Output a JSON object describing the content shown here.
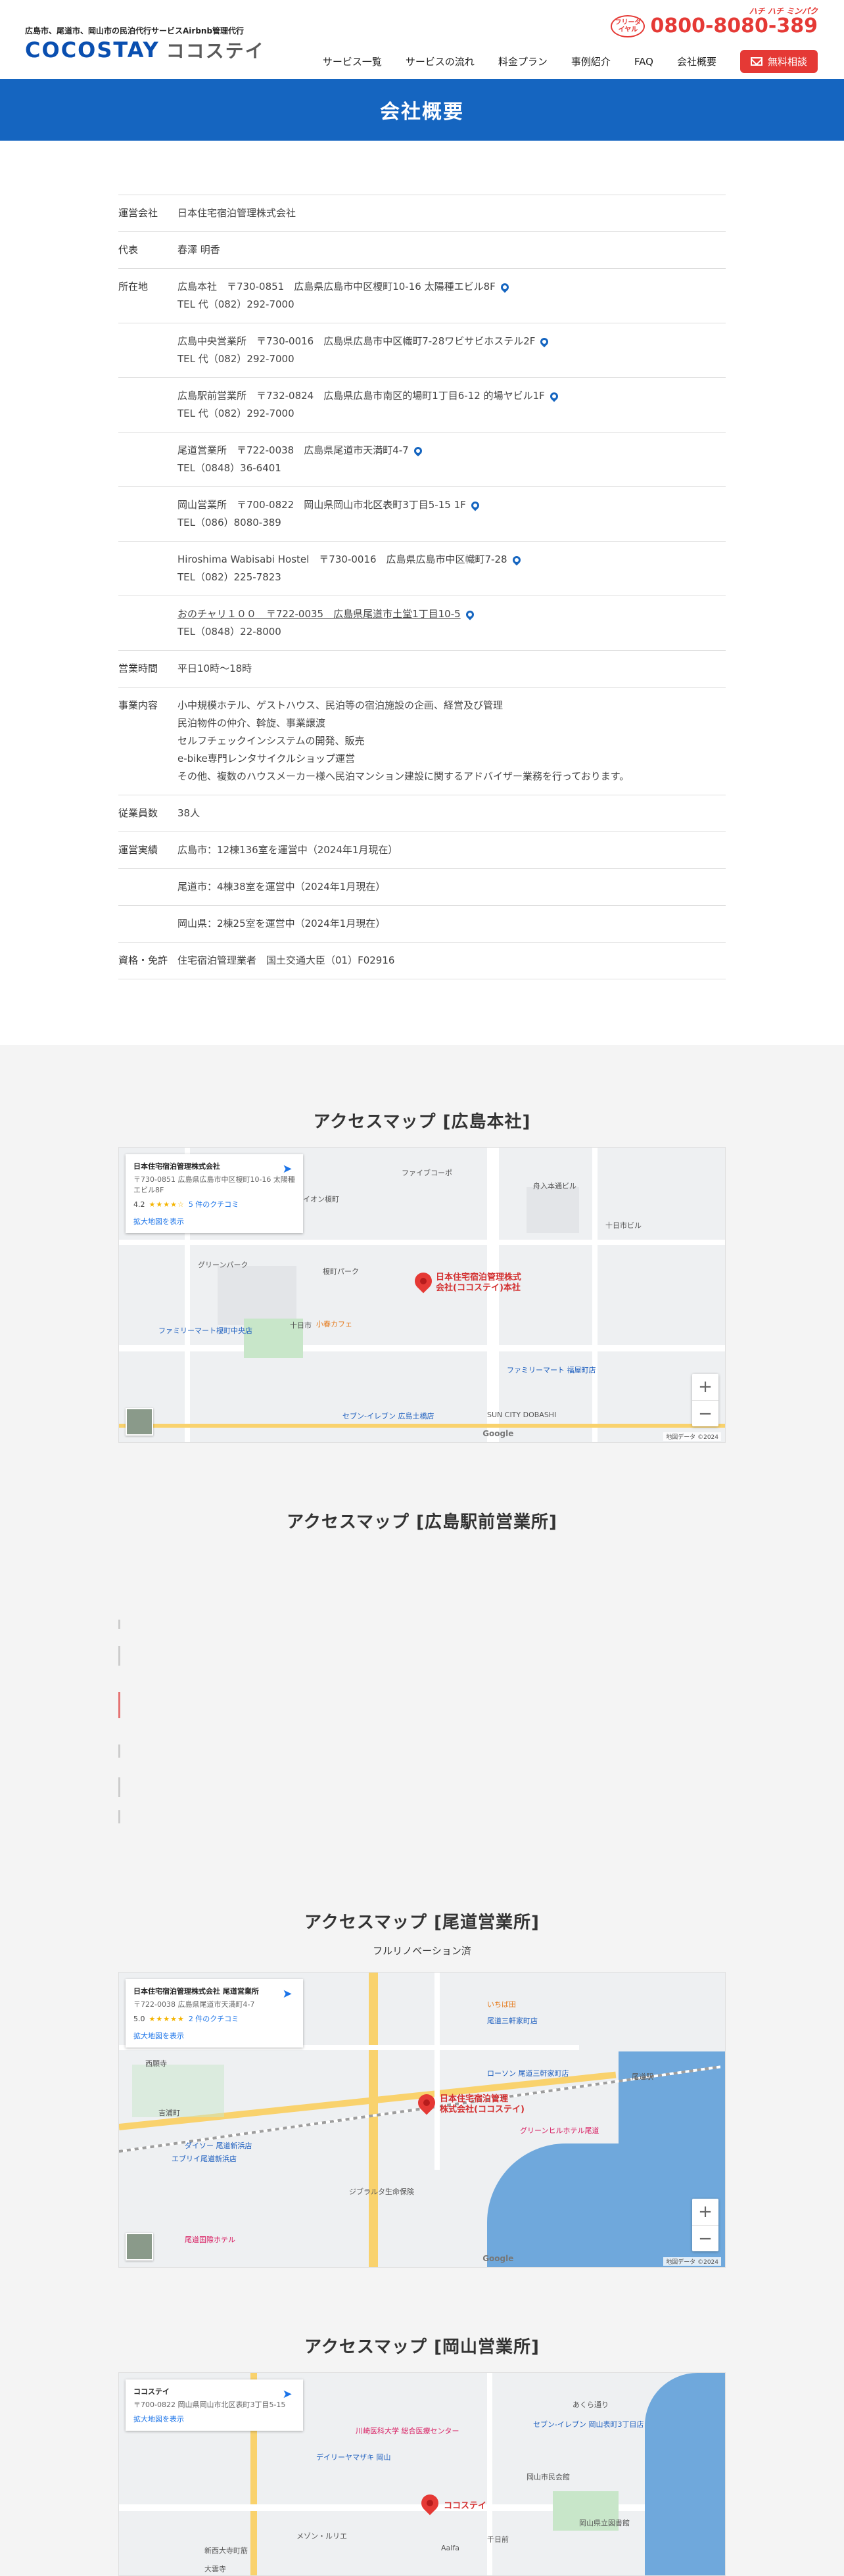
{
  "header": {
    "tagline": "広島市、尾道市、岡山市の民泊代行サービスAirbnb管理代行",
    "logo_en": "COCOSTAY",
    "logo_jp": "ココステイ",
    "phone_badge": "フリーダイヤル",
    "phone_ruby": "ハチ ハチ ミンパク",
    "phone_number": "0800-8080-389",
    "nav": [
      "サービス一覧",
      "サービスの流れ",
      "料金プラン",
      "事例紹介",
      "FAQ",
      "会社概要"
    ],
    "cta": "無料相談"
  },
  "page_title": "会社概要",
  "company": {
    "rows": [
      {
        "label": "運営会社",
        "lines": [
          "日本住宅宿泊管理株式会社"
        ]
      },
      {
        "label": "代表",
        "lines": [
          "春澤 明香"
        ]
      },
      {
        "label": "所在地",
        "lines": [
          "広島本社　〒730-0851　広島県広島市中区榎町10-16 太陽種エビル8F",
          "TEL 代（082）292-7000"
        ],
        "pin": true
      },
      {
        "label": "",
        "lines": [
          "広島中央営業所　〒730-0016　広島県広島市中区幟町7-28ワビサビホステル2F",
          "TEL 代（082）292-7000"
        ],
        "pin": true
      },
      {
        "label": "",
        "lines": [
          "広島駅前営業所　〒732-0824　広島県広島市南区的場町1丁目6-12 的場ヤビル1F",
          "TEL 代（082）292-7000"
        ],
        "pin": true
      },
      {
        "label": "",
        "lines": [
          "尾道営業所　〒722-0038　広島県尾道市天満町4-7",
          "TEL（0848）36-6401"
        ],
        "pin": true
      },
      {
        "label": "",
        "lines": [
          "岡山営業所　〒700-0822　岡山県岡山市北区表町3丁目5-15 1F",
          "TEL（086）8080-389"
        ],
        "pin": true
      },
      {
        "label": "",
        "lines": [
          "Hiroshima Wabisabi Hostel　〒730-0016　広島県広島市中区幟町7-28",
          "TEL（082）225-7823"
        ],
        "pin": true
      },
      {
        "label": "",
        "lines": [
          "おのチャリ１００　〒722-0035　広島県尾道市土堂1丁目10-5",
          "TEL（0848）22-8000"
        ],
        "pin": true,
        "underline_prefix": "おのチャリ１００"
      },
      {
        "label": "営業時間",
        "lines": [
          "平日10時～18時"
        ]
      },
      {
        "label": "事業内容",
        "lines": [
          "小中規模ホテル、ゲストハウス、民泊等の宿泊施設の企画、経営及び管理",
          "民泊物件の仲介、斡旋、事業譲渡",
          "セルフチェックインシステムの開発、販売",
          "e-bike専門レンタサイクルショップ運営",
          "その他、複数のハウスメーカー様へ民泊マンション建設に関するアドバイザー業務を行っております。"
        ]
      },
      {
        "label": "従業員数",
        "lines": [
          "38人"
        ]
      },
      {
        "label": "運営実績",
        "lines": [
          "広島市：12棟136室を運営中（2024年1月現在）"
        ]
      },
      {
        "label": "",
        "lines": [
          "尾道市：4棟38室を運営中（2024年1月現在）"
        ]
      },
      {
        "label": "",
        "lines": [
          "岡山県：2棟25室を運営中（2024年1月現在）"
        ]
      },
      {
        "label": "資格・免許",
        "lines": [
          "住宅宿泊管理業者　国土交通大臣（01）F02916"
        ]
      }
    ]
  },
  "maps": [
    {
      "title": "アクセスマップ [広島本社]",
      "subtitle": "",
      "card": {
        "name": "日本住宅宿泊管理株式会社",
        "addr": "〒730-0851 広島県広島市中区榎町10-16 太陽種エビル8F",
        "rating": "4.2",
        "stars": "★★★★☆",
        "reviews": "5 件のクチコミ",
        "link": "拡大地図を表示"
      },
      "marker_label": [
        "日本住宅宿泊管理株式",
        "会社(ココステイ)本社"
      ],
      "pois": [
        "ファイブコーポ",
        "イオン榎町",
        "榎町パーク",
        "舟入本通ビル",
        "十日市ビル",
        "ファミリーマート榎町中央店",
        "グリーンパーク",
        "セブン-イレブン 広島土橋店",
        "ファミリーマート 福屋町店",
        "SUN CITY DOBASHI",
        "小春カフェ",
        "十日市"
      ],
      "date": "地図データ ©2024",
      "google": "Google"
    },
    {
      "title": "アクセスマップ [広島駅前営業所]",
      "subtitle": ""
    },
    {
      "title": "アクセスマップ [尾道営業所]",
      "subtitle": "フルリノベーション済",
      "card": {
        "name": "日本住宅宿泊管理株式会社 尾道営業所",
        "addr": "〒722-0038 広島県尾道市天満町4-7",
        "rating": "5.0",
        "stars": "★★★★★",
        "reviews": "2 件のクチコミ",
        "link": "拡大地図を表示"
      },
      "marker_label": [
        "日本住宅宿泊管理",
        "株式会社(ココステイ)"
      ],
      "pois": [
        "ローソン 尾道三軒家町店",
        "いちば田",
        "ダイソー 尾道新浜店",
        "エブリイ尾道新浜店",
        "尾道国際ホテル",
        "グリーンヒルホテル尾道",
        "尾道駅",
        "ジブラルタ生命保険",
        "西願寺",
        "吉浦町",
        "尾道三軒家町店"
      ],
      "date": "地図データ ©2024",
      "google": "Google"
    },
    {
      "title": "アクセスマップ [岡山営業所]",
      "subtitle": "",
      "card": {
        "name": "ココステイ",
        "addr": "〒700-0822 岡山県岡山市北区表町3丁目5-15",
        "rating": "",
        "stars": "",
        "reviews": "",
        "link": "拡大地図を表示"
      },
      "marker_label": [
        "ココステイ"
      ],
      "pois": [
        "川崎医科大学 総合医療センター",
        "セブン-イレブン 岡山表町3丁目店",
        "デイリーヤマザキ 岡山",
        "あくら通り",
        "岡山市民会館",
        "岡山県立図書館",
        "新西大寺町筋",
        "大雲寺",
        "Aalfa",
        "メゾン・ルリエ",
        "千日前"
      ],
      "date": "地図データ ©2024",
      "google": "Google"
    }
  ]
}
